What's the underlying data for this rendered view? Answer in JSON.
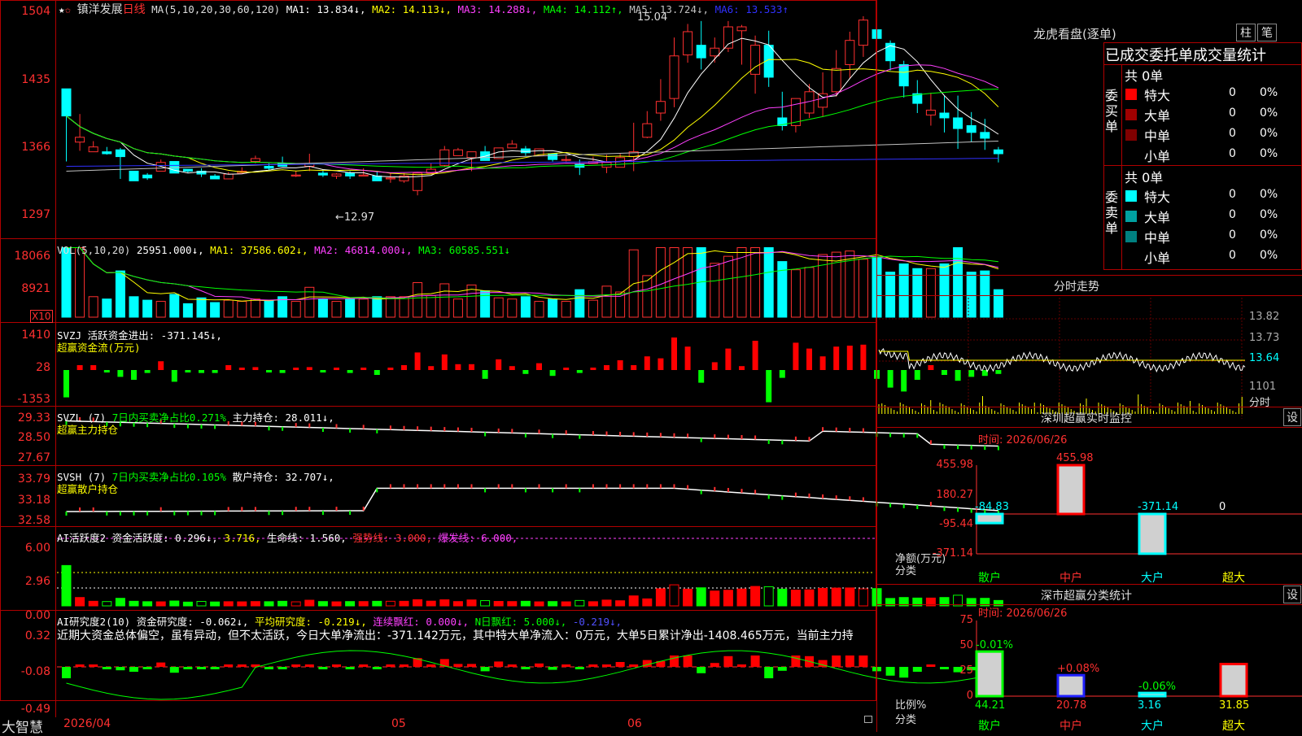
{
  "main": {
    "title_stock": "镇洋发展",
    "title_period": "日线",
    "ma_header": "MA(5,10,20,30,60,120)",
    "ma_vals": [
      "MA1: 13.834↓,",
      "MA2: 14.113↓,",
      "MA3: 14.288↓,",
      "MA4: 14.112↑,",
      "MA5: 13.724↓,",
      "MA6: 13.533↑"
    ],
    "ma_colors": [
      "#ffffff",
      "#ffff00",
      "#ff40ff",
      "#00ff00",
      "#c0c0c0",
      "#3030ff"
    ],
    "price_axis": [
      "1504",
      "1435",
      "1366",
      "1297"
    ],
    "high_label": "15.04",
    "low_label": "←12.97"
  },
  "vol": {
    "header": "VOL(5,10,20)",
    "value": "25951.000↓,",
    "mas": [
      "MA1: 37586.602↓,",
      "MA2: 46814.000↓,",
      "MA3: 60585.551↓"
    ],
    "axis": [
      "18066",
      "8921"
    ],
    "unit": "X10"
  },
  "svzj": {
    "line1": "SVZJ  活跃资金进出: -371.145↓,",
    "line2": "超赢资金流(万元)",
    "axis": [
      "1410",
      "28",
      "-1353"
    ]
  },
  "svzl": {
    "name": "SVZL  (7)",
    "ratio": "7日内买卖净占比0.271%",
    "hold": "主力持仓: 28.011↓,",
    "line2": "超赢主力持仓",
    "axis": [
      "29.33",
      "28.50",
      "27.67"
    ]
  },
  "svsh": {
    "name": "SVSH  (7)",
    "ratio": "7日内买卖净占比0.105%",
    "hold": "散户持仓: 32.707↓,",
    "line2": "超赢散户持仓",
    "axis": [
      "33.79",
      "33.18",
      "32.58"
    ]
  },
  "ai1": {
    "a": "AI活跃度2 资金活跃度: 0.296↓,",
    "b": "3.716,",
    "c": "生命线: 1.560,",
    "d": "强势线: 3.000,",
    "e": "爆发线: 6.000,",
    "axis": [
      "6.00",
      "2.96",
      "0.00"
    ]
  },
  "ai2": {
    "a": "AI研究度2(10) 资金研究度: -0.062↓,",
    "b": "平均研究度: -0.219↓,",
    "c": "连续飘红: 0.000↓,",
    "d": "N日飘红: 5.000↓,",
    "e": "-0.219↓,",
    "desc": "近期大资金总体偏空，虽有异动，但不太活跃，今日大单净流出：-371.142万元，其中特大单净流入：0万元，大单5日累计净出-1408.465万元，当前主力持",
    "axis": [
      "0.32",
      "-0.08",
      "-0.49"
    ]
  },
  "footer": {
    "brand": "大智慧",
    "dates": [
      "2026/04",
      "05",
      "06"
    ]
  },
  "right": {
    "title": "龙虎看盘(逐单)",
    "btn1": "柱",
    "btn2": "笔",
    "tabs": "已成交委托单成交量统计",
    "buy_label": "委买单",
    "sell_label": "委卖单",
    "buy_total": "共 0单",
    "sell_total": "共 0单",
    "rows": [
      {
        "name": "特大",
        "v": "0",
        "p": "0%"
      },
      {
        "name": "大单",
        "v": "0",
        "p": "0%"
      },
      {
        "name": "中单",
        "v": "0",
        "p": "0%"
      },
      {
        "name": "小单",
        "v": "0",
        "p": "0%"
      }
    ],
    "buy_colors": [
      "#ff0000",
      "#a00000",
      "#800000",
      "#000000"
    ],
    "sell_colors": [
      "#00ffff",
      "#00a0a0",
      "#008080",
      "#000000"
    ],
    "fenshi_title": "分时走势",
    "fenshi_axis": [
      "13.82",
      "13.73",
      "13.64",
      "1101"
    ],
    "fenshi_unit": "分时",
    "monitor_title": "深圳超赢实时监控",
    "monitor_set": "设",
    "monitor_time": "时间: 2026/06/26",
    "monitor_axis": [
      "455.98",
      "180.27",
      "-95.44",
      "-371.14"
    ],
    "monitor_vals": [
      "-84.83",
      "455.98",
      "-371.14",
      "0"
    ],
    "monitor_cats": [
      "散户",
      "中户",
      "大户",
      "超大"
    ],
    "monitor_ylabel": "净额(万元)",
    "monitor_xlabel": "分类",
    "stat_title": "深市超赢分类统计",
    "stat_set": "设",
    "stat_time": "时间: 2026/06/26",
    "stat_axis": [
      "75",
      "50",
      "25",
      "0"
    ],
    "stat_top": [
      "-0.01%",
      "+0.08%",
      "-0.06%",
      ""
    ],
    "stat_vals": [
      "44.21",
      "20.78",
      "3.16",
      "31.85"
    ],
    "stat_cats": [
      "散户",
      "中户",
      "大户",
      "超大"
    ],
    "stat_ylabel": "比例%",
    "stat_xlabel": "分类"
  },
  "chart_data": {
    "type": "candlestick",
    "candles": [
      [
        14.25,
        14.25,
        13.97,
        13.5
      ],
      [
        13.7,
        13.99,
        13.75,
        13.61
      ],
      [
        13.6,
        13.71,
        13.65,
        13.61
      ],
      [
        13.6,
        13.65,
        13.58,
        13.57
      ],
      [
        13.62,
        13.64,
        13.55,
        13.32
      ],
      [
        13.4,
        13.4,
        13.3,
        13.3
      ],
      [
        13.36,
        13.38,
        13.33,
        13.31
      ],
      [
        13.4,
        13.52,
        13.49,
        13.46
      ],
      [
        13.5,
        13.5,
        13.38,
        13.38
      ],
      [
        13.42,
        13.42,
        13.4,
        13.38
      ],
      [
        13.4,
        13.43,
        13.37,
        13.34
      ],
      [
        13.35,
        13.37,
        13.32,
        13.32
      ],
      [
        13.32,
        13.39,
        13.37,
        13.32
      ],
      [
        13.38,
        13.44,
        13.4,
        13.38
      ],
      [
        13.5,
        13.56,
        13.53,
        13.48
      ],
      [
        13.45,
        13.48,
        13.43,
        13.41
      ],
      [
        13.48,
        13.55,
        13.45,
        13.45
      ],
      [
        13.35,
        13.4,
        13.36,
        13.34
      ],
      [
        13.45,
        13.58,
        13.48,
        13.4
      ],
      [
        13.38,
        13.42,
        13.36,
        13.34
      ],
      [
        13.35,
        13.38,
        13.37,
        13.32
      ],
      [
        13.38,
        13.4,
        13.35,
        13.32
      ],
      [
        13.35,
        13.43,
        13.36,
        13.35
      ],
      [
        13.35,
        13.4,
        13.3,
        13.3
      ],
      [
        13.32,
        13.38,
        13.33,
        13.28
      ],
      [
        13.3,
        13.38,
        13.35,
        13.28
      ],
      [
        13.2,
        13.37,
        13.38,
        13.15
      ],
      [
        13.38,
        13.48,
        13.42,
        13.37
      ],
      [
        13.46,
        13.66,
        13.62,
        13.45
      ],
      [
        13.56,
        13.64,
        13.62,
        13.56
      ],
      [
        13.54,
        13.6,
        13.6,
        13.4
      ],
      [
        13.6,
        13.66,
        13.51,
        13.51
      ],
      [
        13.53,
        13.62,
        13.64,
        13.53
      ],
      [
        13.64,
        13.72,
        13.68,
        13.64
      ],
      [
        13.63,
        13.66,
        13.59,
        13.56
      ],
      [
        13.56,
        13.62,
        13.63,
        13.56
      ],
      [
        13.58,
        13.58,
        13.52,
        13.5
      ],
      [
        13.52,
        13.56,
        13.52,
        13.5
      ],
      [
        13.47,
        13.52,
        13.44,
        13.36
      ],
      [
        13.48,
        13.55,
        13.5,
        13.48
      ],
      [
        13.44,
        13.57,
        13.49,
        13.38
      ],
      [
        13.44,
        13.58,
        13.54,
        13.44
      ],
      [
        13.55,
        13.9,
        13.6,
        13.4
      ],
      [
        13.75,
        14.02,
        13.89,
        13.74
      ],
      [
        14.0,
        14.35,
        14.12,
        13.92
      ],
      [
        14.15,
        14.78,
        14.59,
        14.06
      ],
      [
        14.6,
        14.92,
        14.84,
        14.52
      ],
      [
        14.7,
        14.95,
        14.57,
        14.45
      ],
      [
        14.59,
        14.78,
        14.67,
        14.52
      ],
      [
        14.67,
        14.95,
        14.89,
        14.63
      ],
      [
        14.85,
        14.91,
        14.89,
        14.5
      ],
      [
        14.4,
        14.8,
        14.7,
        14.2
      ],
      [
        14.7,
        14.85,
        14.37,
        14.27
      ],
      [
        13.95,
        14.22,
        13.87,
        13.82
      ],
      [
        13.87,
        14.13,
        14.15,
        13.8
      ],
      [
        14.0,
        14.3,
        14.22,
        13.95
      ],
      [
        14.06,
        14.42,
        14.2,
        13.96
      ],
      [
        14.22,
        14.65,
        14.46,
        14.17
      ],
      [
        14.5,
        14.84,
        14.75,
        14.35
      ],
      [
        14.7,
        15.0,
        14.96,
        14.58
      ],
      [
        14.86,
        15.0,
        14.77,
        14.56
      ],
      [
        14.72,
        14.75,
        14.54,
        14.44
      ],
      [
        14.5,
        14.54,
        14.28,
        14.16
      ],
      [
        14.2,
        14.34,
        14.1,
        14.0
      ],
      [
        13.98,
        14.21,
        14.03,
        13.87
      ],
      [
        14.0,
        14.18,
        13.95,
        13.8
      ],
      [
        13.95,
        14.18,
        13.84,
        13.63
      ],
      [
        13.87,
        14.01,
        13.8,
        13.7
      ],
      [
        13.8,
        13.94,
        13.74,
        13.62
      ],
      [
        13.62,
        13.65,
        13.58,
        13.49
      ]
    ]
  }
}
